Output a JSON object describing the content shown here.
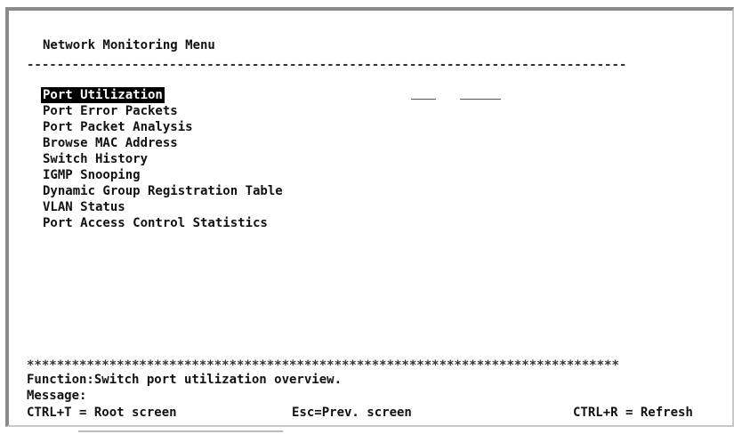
{
  "screen": {
    "title": "Network Monitoring Menu",
    "separator": "--------------------------------------------------------------------------------",
    "menu_items": [
      "Port Utilization",
      "Port Error Packets",
      "Port Packet Analysis",
      "Browse MAC Address",
      "Switch History",
      "IGMP Snooping",
      "Dynamic Group Registration Table",
      "VLAN Status",
      "Port Access Control Statistics"
    ],
    "selected_item": "Port Utilization",
    "stars": "*******************************************************************************",
    "function_text": "Function:Switch port utilization overview.",
    "message_text": "Message:",
    "keys": {
      "root": "CTRL+T = Root screen",
      "prev": "Esc=Prev. screen",
      "refresh": "CTRL+R = Refresh"
    }
  },
  "colors": {
    "background": "#ffffff",
    "text": "#111111",
    "highlight_bg": "#000000",
    "highlight_fg": "#ffffff"
  }
}
